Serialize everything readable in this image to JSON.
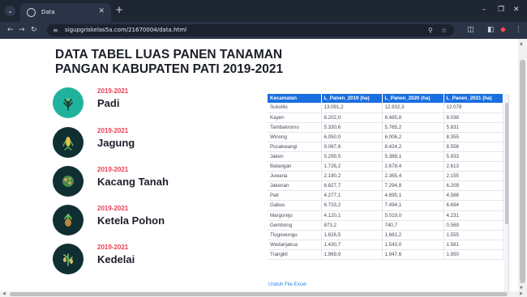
{
  "browser": {
    "tab_title": "Data",
    "url": "sigupgriskelas5a.com/21670004/data.html",
    "icons": [
      "tab-menu-icon",
      "tab-favicon-icon",
      "close-icon",
      "new-tab-icon",
      "minimize-icon",
      "maximize-icon",
      "window-close-icon",
      "back-icon",
      "forward-icon",
      "reload-icon",
      "site-settings-icon",
      "zoom-icon",
      "bookmark-star-icon",
      "extensions-icon",
      "sidebar-icon",
      "profile-icon",
      "menu-icon"
    ]
  },
  "page": {
    "title": "DATA TABEL LUAS PANEN TANAMAN PANGAN KABUPATEN PATI 2019-2021",
    "crops": [
      {
        "years": "2019-2021",
        "name": "Padi",
        "icon": "rice-plant-icon"
      },
      {
        "years": "2019-2021",
        "name": "Jagung",
        "icon": "corn-icon"
      },
      {
        "years": "2019-2021",
        "name": "Kacang Tanah",
        "icon": "peanut-icon"
      },
      {
        "years": "2019-2021",
        "name": "Ketela Pohon",
        "icon": "cassava-icon"
      },
      {
        "years": "2019-2021",
        "name": "Kedelai",
        "icon": "soybean-icon"
      }
    ],
    "download_label": "Unduh File Excel"
  },
  "table": {
    "headers": [
      "Kecamatan",
      "L_Panen_2019 (ha)",
      "L_Panen_2020 (ha)",
      "L_Panen_2021 (ha)"
    ],
    "rows": [
      [
        "Sukolilo",
        "13.091,2",
        "12.932,3",
        "12.078"
      ],
      [
        "Kayen",
        "8.202,0",
        "8.485,8",
        "8.038"
      ],
      [
        "Tambakromo",
        "5.330,6",
        "5.765,2",
        "5.831"
      ],
      [
        "Winong",
        "6.050,0",
        "6.006,2",
        "8.355"
      ],
      [
        "Pucakwangi",
        "9.067,6",
        "8.424,2",
        "8.556"
      ],
      [
        "Jaken",
        "5.299,5",
        "5.388,1",
        "5.933"
      ],
      [
        "Batangan",
        "1.726,2",
        "2.678,4",
        "2.613"
      ],
      [
        "Juwana",
        "2.190,2",
        "2.365,4",
        "2.155"
      ],
      [
        "Jakenan",
        "6.827,7",
        "7.294,8",
        "6.209"
      ],
      [
        "Pati",
        "4.277,1",
        "4.695,1",
        "4.586"
      ],
      [
        "Gabus",
        "6.733,2",
        "7.494,1",
        "6.694"
      ],
      [
        "Margorejo",
        "4.120,1",
        "5.019,0",
        "4.231"
      ],
      [
        "Gembong",
        "873,2",
        "740,7",
        "0.569"
      ],
      [
        "Tlogowungu",
        "1.826,5",
        "1.681,2",
        "1.555"
      ],
      [
        "Wedarijaksa",
        "1.430,7",
        "1.543,0",
        "1.581"
      ],
      [
        "Trangkil",
        "1.969,9",
        "1.947,6",
        "1.950"
      ]
    ]
  },
  "colors": {
    "header_bg": "#1a6fe0",
    "years_accent": "#ea3e54",
    "padi_circle": "#1fb39e",
    "crop_circle": "#0f2f33",
    "link": "#2b7fe6"
  }
}
